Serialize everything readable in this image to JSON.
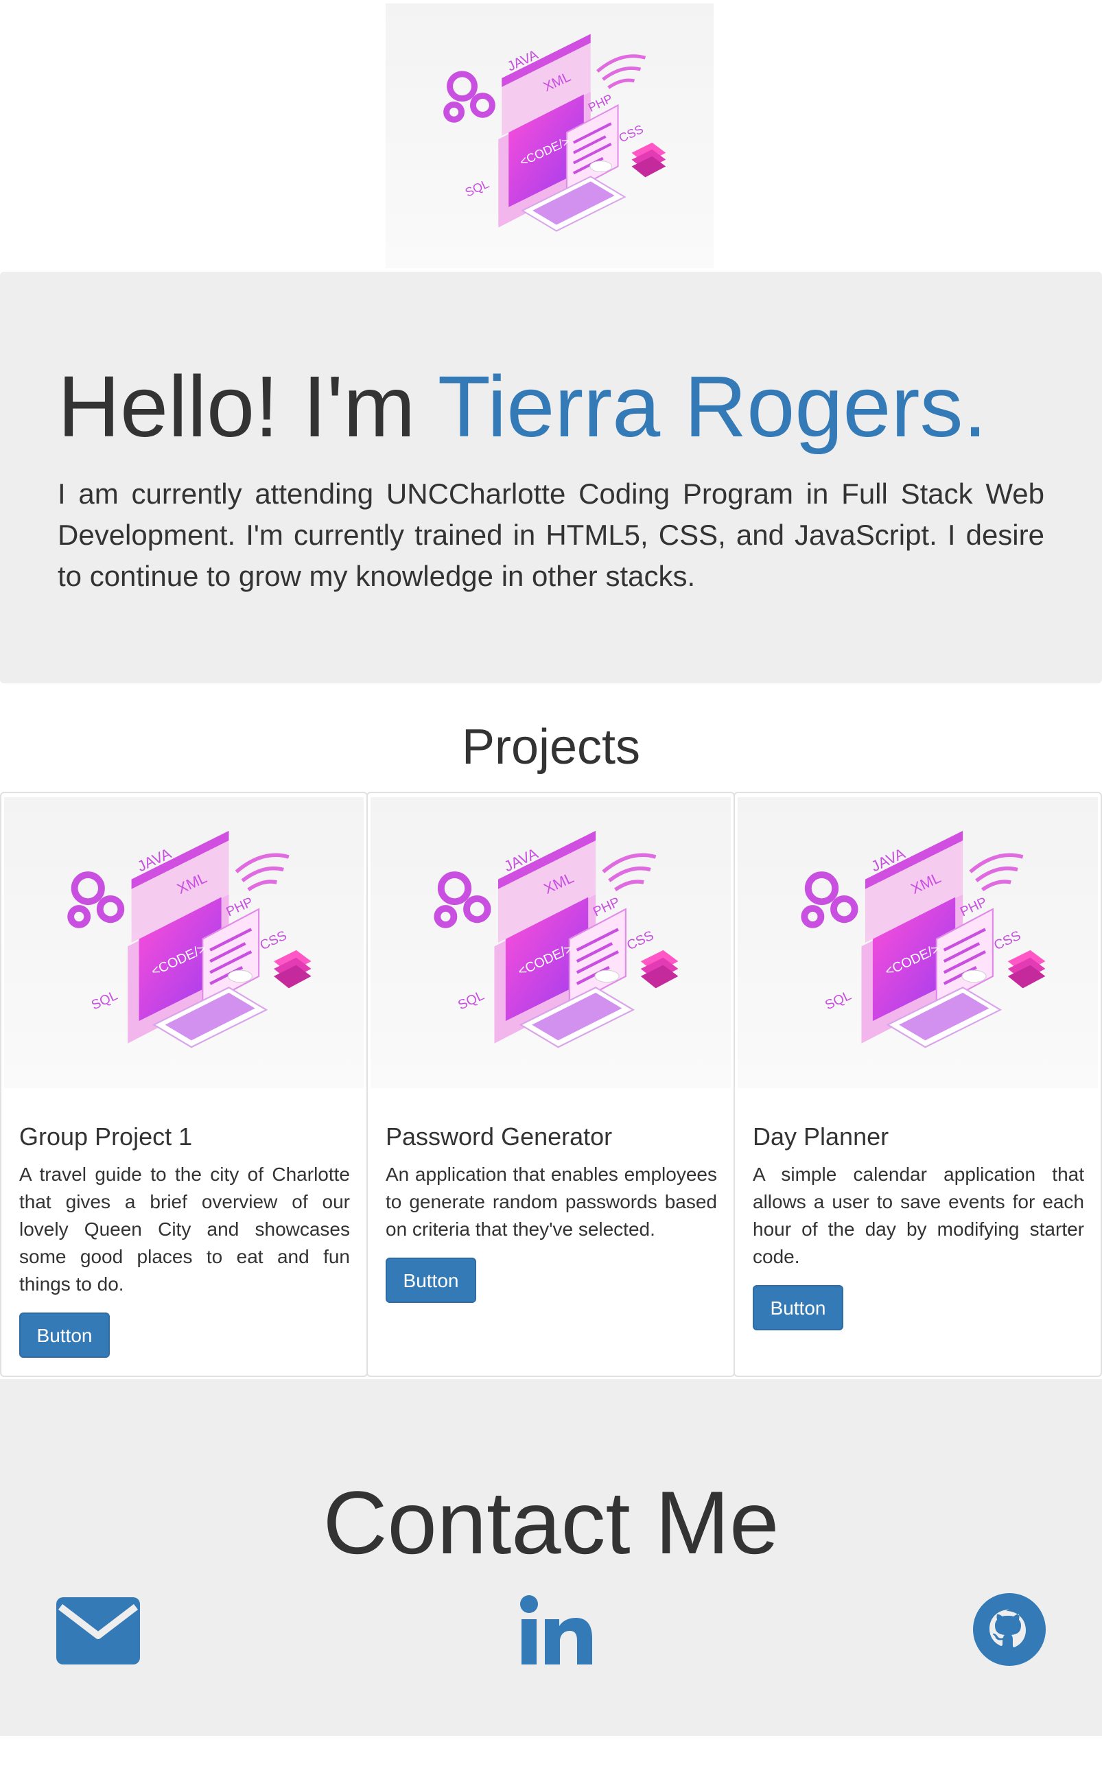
{
  "hero": {
    "greeting": "Hello! I'm",
    "name": "Tierra Rogers.",
    "bio": "I am currently attending UNCCharlotte Coding Program in Full Stack Web Development. I'm currently trained in HTML5, CSS, and JavaScript. I desire to continue to grow my knowledge in other stacks."
  },
  "illustration_labels": {
    "java": "JAVA",
    "xml": "XML",
    "php": "PHP",
    "code": "<CODE/>",
    "css": "CSS",
    "sql": "SQL"
  },
  "projects": {
    "title": "Projects",
    "cards": [
      {
        "title": "Group Project 1",
        "text": "A travel guide to the city of Charlotte that gives a brief overview of our lovely Queen City and showcases some good places to eat and fun things to do.",
        "button": "Button"
      },
      {
        "title": "Password Generator",
        "text": "An application that enables employees to generate random passwords based on criteria that they've selected.",
        "button": "Button"
      },
      {
        "title": "Day Planner",
        "text": "A simple calendar application that allows a user to save events for each hour of the day by modifying starter code.",
        "button": "Button"
      }
    ]
  },
  "contact": {
    "title": "Contact Me",
    "icons": [
      "envelope-icon",
      "linkedin-icon",
      "github-icon"
    ]
  },
  "colors": {
    "accent": "#337ab7",
    "panel": "#eeeeee",
    "text": "#333333"
  }
}
